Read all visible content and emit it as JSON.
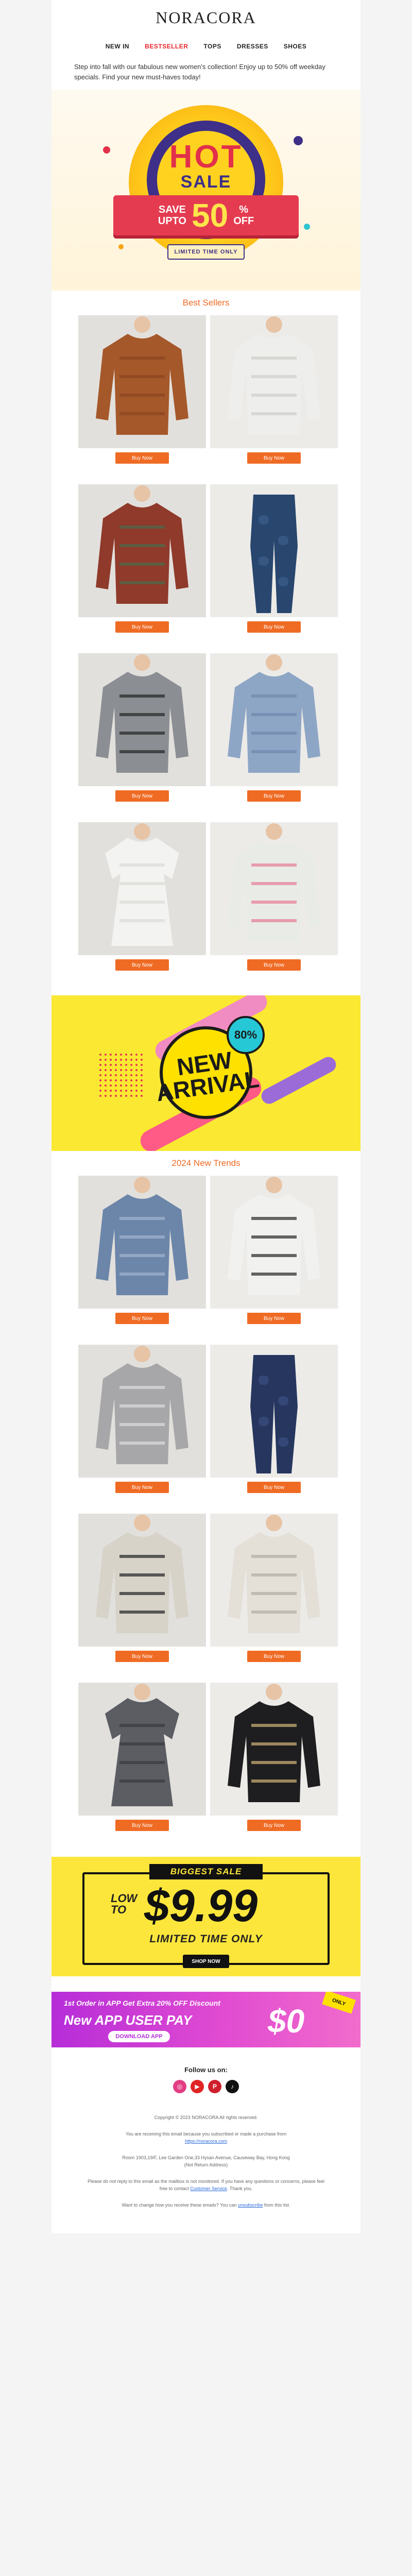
{
  "header": {
    "logo": "NORACORA",
    "nav": [
      "NEW IN",
      "BESTSELLER",
      "TOPS",
      "DRESSES",
      "SHOES"
    ],
    "intro": "Step into fall with our fabulous new women's collection! Enjoy up to 50% off weekday specials. Find your new must-haves today!"
  },
  "hero_hot": {
    "hot": "HOT",
    "sale": "SALE",
    "save": "SAVE",
    "upto": "UPTO",
    "number": "50",
    "percent": "%",
    "off": "OFF",
    "limited": "LIMITED TIME ONLY"
  },
  "best_sellers": {
    "title": "Best Sellers",
    "button": "Buy Now",
    "items": [
      {
        "name": "brown-ribbed-top",
        "color": "#a5582a",
        "accent": "#8c4520"
      },
      {
        "name": "white-lace-top",
        "color": "#eeeeec",
        "accent": "#cfcfcc"
      },
      {
        "name": "patchwork-top",
        "color": "#8f3a2b",
        "accent": "#4c6a4b"
      },
      {
        "name": "printed-leggings",
        "color": "#28466e",
        "accent": "#3b5d8a"
      },
      {
        "name": "striped-sweatshirt",
        "color": "#8b8e93",
        "accent": "#2b2b2b"
      },
      {
        "name": "blue-knit-top",
        "color": "#8ea6c6",
        "accent": "#6f89ad"
      },
      {
        "name": "white-tunic",
        "color": "#f3f3f1",
        "accent": "#dcdcd8"
      },
      {
        "name": "floral-jacket",
        "color": "#e9ece6",
        "accent": "#e5829a"
      }
    ]
  },
  "hero_arrival": {
    "line1": "NEW",
    "line2": "ARRIVAL",
    "badge": "80%"
  },
  "new_trends": {
    "title": "2024 New Trends",
    "button": "Buy Now",
    "items": [
      {
        "name": "blue-paisley-sweatshirt",
        "color": "#6c86aa",
        "accent": "#9fb2cc"
      },
      {
        "name": "white-lace-up-sweatshirt",
        "color": "#f1f1f0",
        "accent": "#333333"
      },
      {
        "name": "sequin-top",
        "color": "#a7a7a9",
        "accent": "#d9d9dc"
      },
      {
        "name": "navy-leggings",
        "color": "#26365e",
        "accent": "#3a4d80"
      },
      {
        "name": "cat-print-cardigan",
        "color": "#d7d3c9",
        "accent": "#2d2d2d"
      },
      {
        "name": "floral-fleece-top",
        "color": "#e4dfd7",
        "accent": "#b6b0a5"
      },
      {
        "name": "gray-tunic-dress",
        "color": "#5b5d63",
        "accent": "#3b3c40"
      },
      {
        "name": "black-button-top",
        "color": "#1e1e20",
        "accent": "#c8ab73"
      }
    ]
  },
  "hero_biggest": {
    "label": "BIGGEST SALE",
    "low": "LOW",
    "to": "TO",
    "price": "$9.99",
    "limited": "LIMITED TIME ONLY",
    "shop": "SHOP NOW"
  },
  "hero_app": {
    "top": "1st Order in APP Get Extra 20% OFF Discount",
    "main": "New APP USER PAY",
    "button": "DOWNLOAD APP",
    "amount": "$0",
    "tag": "ONLY"
  },
  "follow": {
    "title": "Follow us on:",
    "icons": [
      {
        "name": "instagram-icon",
        "glyph": "◎",
        "color": "#e23d83"
      },
      {
        "name": "youtube-icon",
        "glyph": "▶",
        "color": "#e02424"
      },
      {
        "name": "pinterest-icon",
        "glyph": "P",
        "color": "#cf1f2c"
      },
      {
        "name": "tiktok-icon",
        "glyph": "♪",
        "color": "#111111"
      }
    ]
  },
  "footer": {
    "copyright": "Copyright © 2023 NORACORA All rights reserved.",
    "subscribed_1": "You are receiving this email because you subscribed or made a purchase from",
    "subscribed_link": "https://noracora.com",
    "address_1": "Room 1903,19/F, Lee Garden One,33 Hysan Avenue, Causeway Bay, Hong Kong",
    "address_2": "(Not Return Address)",
    "noreply_1": "Please do not reply to this email as the mailbox is not monitored. If you have any questions or concerns, please feel free to contact",
    "noreply_link": "Customer Service",
    "noreply_2": "Thank you.",
    "unsub_1": "Want to change how you receive these emails? You can",
    "unsub_link": "unsubscribe",
    "unsub_2": "from this list."
  }
}
